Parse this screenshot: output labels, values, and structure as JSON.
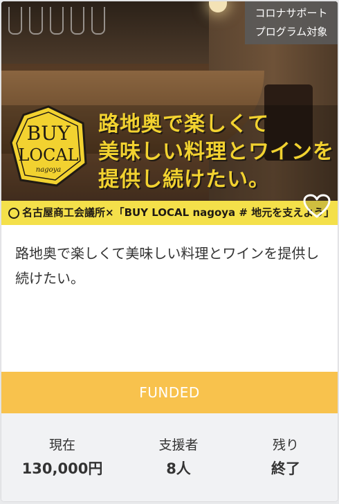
{
  "badge": {
    "line1": "コロナサポート",
    "line2": "プログラム対象"
  },
  "hero": {
    "logo_text_top": "BUY",
    "logo_text_mid": "LOCAL",
    "logo_text_bottom": "nagoya",
    "headline": [
      "路地奥で楽しくて",
      "美味しい料理とワインを",
      "提供し続けたい。"
    ],
    "strip_text": "名古屋商工会議所×「BUY LOCAL nagoya # 地元を支えよう」",
    "accent_color": "#f2d230",
    "strip_color": "#f4e04a"
  },
  "favorite": {
    "icon": "heart-icon"
  },
  "project": {
    "title": "路地奥で楽しくて美味しい料理とワインを提供し続けたい。"
  },
  "status": {
    "label": "FUNDED",
    "color": "#f8c24d"
  },
  "stats": [
    {
      "label": "現在",
      "value": "130,000円"
    },
    {
      "label": "支援者",
      "value": "8人"
    },
    {
      "label": "残り",
      "value": "終了"
    }
  ]
}
